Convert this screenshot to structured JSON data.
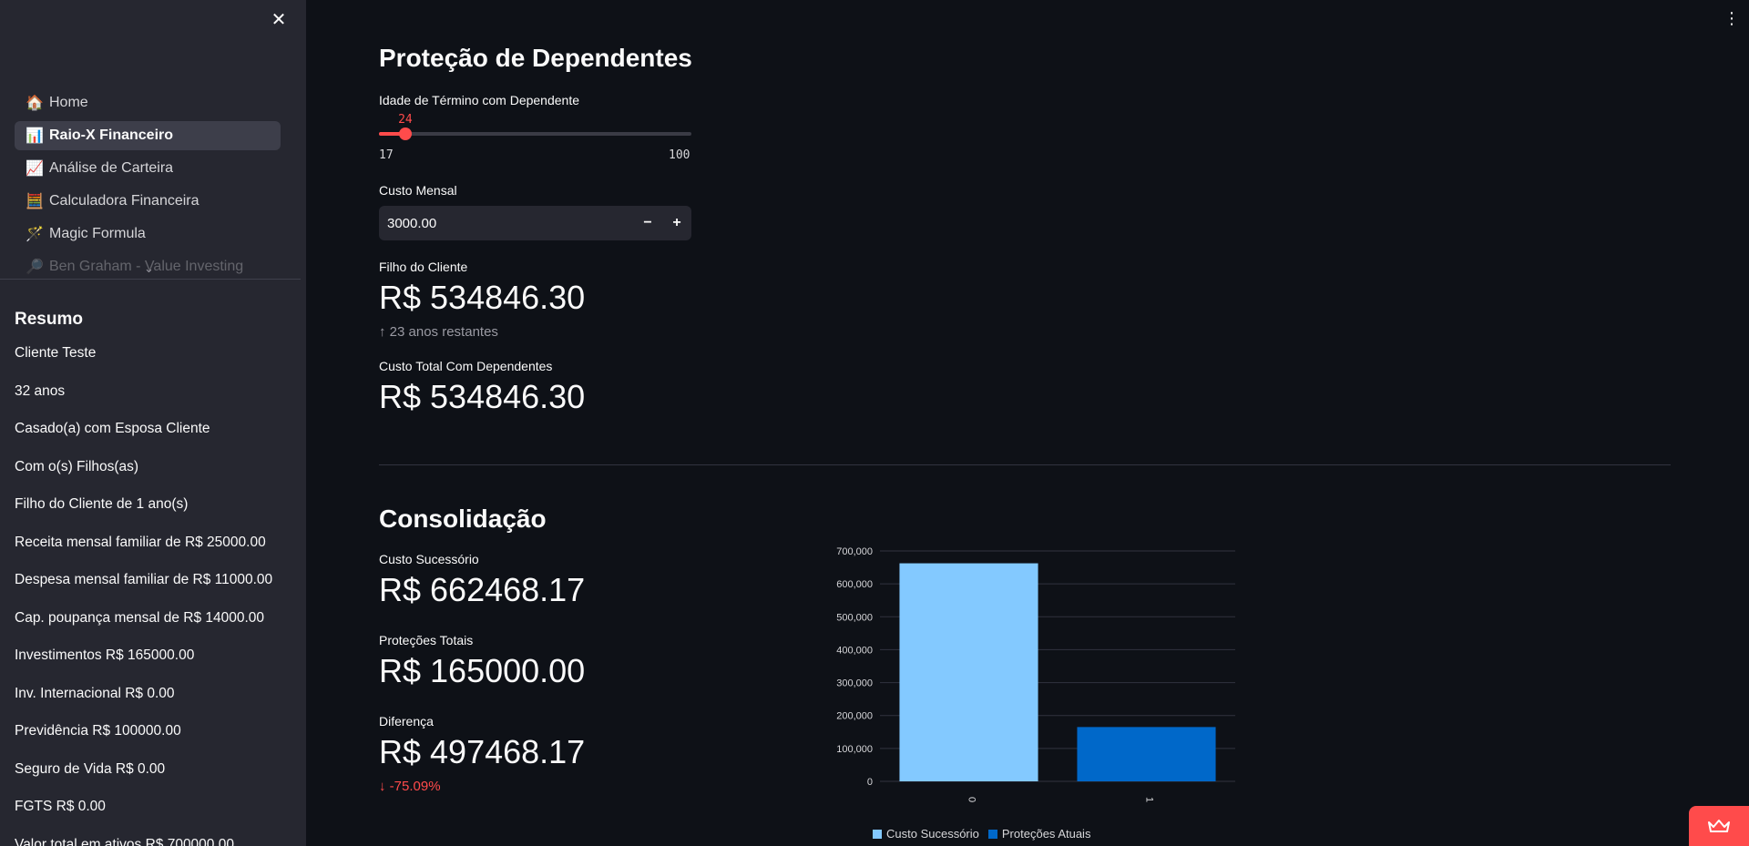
{
  "sidebar": {
    "close_symbol": "✕",
    "nav": [
      {
        "icon": "🏠",
        "label": "Home",
        "active": false
      },
      {
        "icon": "📊",
        "label": "Raio-X Financeiro",
        "active": true
      },
      {
        "icon": "📈",
        "label": "Análise de Carteira",
        "active": false
      },
      {
        "icon": "🧮",
        "label": "Calculadora Financeira",
        "active": false
      },
      {
        "icon": "🪄",
        "label": "Magic Formula",
        "active": false
      },
      {
        "icon": "🔎",
        "label": "Ben Graham - Value Investing",
        "active": false
      }
    ],
    "summary": {
      "title": "Resumo",
      "items": [
        "Cliente Teste",
        "32 anos",
        "Casado(a) com Esposa Cliente",
        "Com o(s) Filhos(as)",
        "Filho do Cliente de 1 ano(s)",
        "Receita mensal familiar de R$ 25000.00",
        "Despesa mensal familiar de R$ 11000.00",
        "Cap. poupança mensal de R$ 14000.00",
        "Investimentos R$ 165000.00",
        "Inv. Internacional R$ 0.00",
        "Previdência R$ 100000.00",
        "Seguro de Vida R$ 0.00",
        "FGTS R$ 0.00",
        "Valor total em ativos R$ 700000.00"
      ]
    }
  },
  "protecao": {
    "title": "Proteção de Dependentes",
    "slider": {
      "label": "Idade de Término com Dependente",
      "value": 24,
      "min": 17,
      "max": 100
    },
    "custo_mensal": {
      "label": "Custo Mensal",
      "value": "3000.00",
      "minus": "−",
      "plus": "+"
    },
    "filho_metric": {
      "label": "Filho do Cliente",
      "value": "R$ 534846.30",
      "delta_arrow": "↑",
      "delta": "23 anos restantes"
    },
    "total_metric": {
      "label": "Custo Total Com Dependentes",
      "value": "R$ 534846.30"
    }
  },
  "consolidacao": {
    "title": "Consolidação",
    "metrics": [
      {
        "label": "Custo Sucessório",
        "value": "R$ 662468.17"
      },
      {
        "label": "Proteções Totais",
        "value": "R$ 165000.00"
      },
      {
        "label": "Diferença",
        "value": "R$ 497468.17",
        "delta_arrow": "↓",
        "delta": "-75.09%"
      }
    ]
  },
  "chart_data": {
    "type": "bar",
    "categories": [
      "0",
      "1"
    ],
    "series": [
      {
        "name": "Custo Sucessório",
        "values": [
          662468.17,
          null
        ],
        "color": "#83c9ff"
      },
      {
        "name": "Proteções Atuais",
        "values": [
          null,
          165000.0
        ],
        "color": "#0068c9"
      }
    ],
    "y_ticks": [
      "0",
      "100,000",
      "200,000",
      "300,000",
      "400,000",
      "500,000",
      "600,000",
      "700,000"
    ],
    "ylim": [
      0,
      700000
    ],
    "grid": true,
    "legend_position": "bottom"
  },
  "colors": {
    "background": "#0e1117",
    "sidebar": "#262730",
    "accent": "#ff4b4b"
  }
}
